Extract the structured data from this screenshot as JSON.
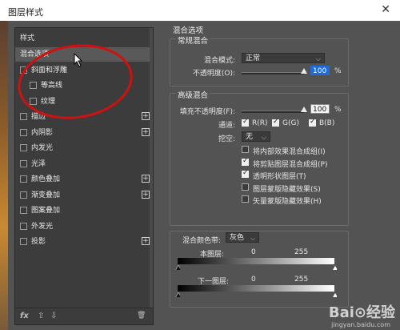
{
  "window": {
    "title": "图层样式",
    "close": "✕"
  },
  "styles_panel": {
    "header": "样式",
    "items": [
      {
        "label": "混合选项",
        "checkbox": false,
        "selected": true,
        "plus": false
      },
      {
        "label": "斜面和浮雕",
        "checkbox": true,
        "selected": false,
        "plus": false
      },
      {
        "label": "等高线",
        "checkbox": true,
        "selected": false,
        "plus": false,
        "indent": true
      },
      {
        "label": "纹理",
        "checkbox": true,
        "selected": false,
        "plus": false,
        "indent": true
      },
      {
        "label": "描边",
        "checkbox": true,
        "selected": false,
        "plus": true
      },
      {
        "label": "内阴影",
        "checkbox": true,
        "selected": false,
        "plus": true
      },
      {
        "label": "内发光",
        "checkbox": true,
        "selected": false,
        "plus": false
      },
      {
        "label": "光泽",
        "checkbox": true,
        "selected": false,
        "plus": false
      },
      {
        "label": "颜色叠加",
        "checkbox": true,
        "selected": false,
        "plus": true
      },
      {
        "label": "渐变叠加",
        "checkbox": true,
        "selected": false,
        "plus": true
      },
      {
        "label": "图案叠加",
        "checkbox": true,
        "selected": false,
        "plus": false
      },
      {
        "label": "外发光",
        "checkbox": true,
        "selected": false,
        "plus": false
      },
      {
        "label": "投影",
        "checkbox": true,
        "selected": false,
        "plus": true
      }
    ],
    "footer": {
      "fx": "fx",
      "up": "⇧",
      "down": "⇩",
      "trash": "🗑"
    }
  },
  "blend_options": {
    "title": "混合选项",
    "general": {
      "title": "常规混合",
      "mode_label": "混合模式:",
      "mode_value": "正常",
      "opacity_label": "不透明度(O):",
      "opacity_value": "100",
      "opacity_unit": "%"
    },
    "advanced": {
      "title": "高级混合",
      "fill_label": "填充不透明度(F):",
      "fill_value": "100",
      "fill_unit": "%",
      "channels_label": "通道:",
      "channels": [
        {
          "label": "R(R)",
          "checked": true
        },
        {
          "label": "G(G)",
          "checked": true
        },
        {
          "label": "B(B)",
          "checked": true
        }
      ],
      "knockout_label": "挖空:",
      "knockout_value": "无",
      "options": [
        {
          "label": "将内部效果混合成组(I)",
          "checked": false
        },
        {
          "label": "将剪贴图层混合成组(P)",
          "checked": true
        },
        {
          "label": "透明形状图层(T)",
          "checked": true
        },
        {
          "label": "图层蒙版隐藏效果(S)",
          "checked": false
        },
        {
          "label": "矢量蒙版隐藏效果(H)",
          "checked": false
        }
      ]
    },
    "blend_if": {
      "label": "混合颜色带:",
      "value": "灰色",
      "this_layer_label": "本图层:",
      "this_layer_low": "0",
      "this_layer_high": "255",
      "underlying_label": "下一图层:",
      "underlying_low": "0",
      "underlying_high": "255"
    }
  },
  "watermark": {
    "brand": "Bai⊙经验",
    "url": "jingyan.baidu.com"
  }
}
